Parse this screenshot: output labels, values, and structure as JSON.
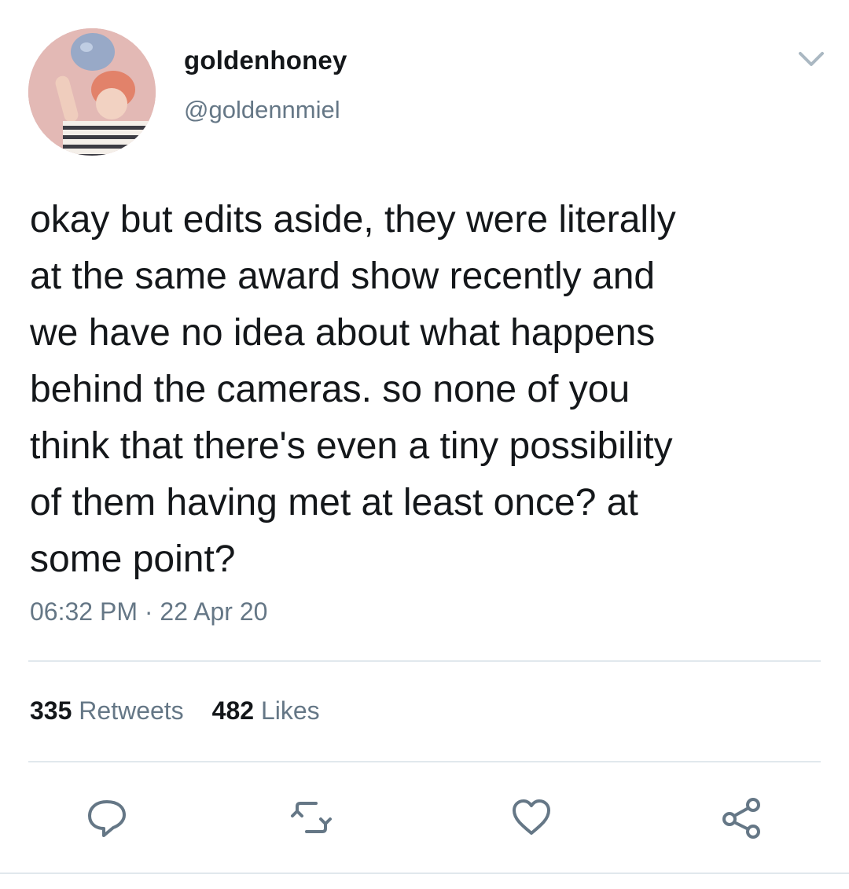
{
  "tweet": {
    "display_name": "goldenhoney",
    "handle": "@goldennmiel",
    "text": "okay but edits aside, they were literally\nat the same award show recently and\nwe have no idea about what happens\nbehind the cameras. so none of you\nthink that there's even a tiny possibility\nof them having met at least once? at\nsome point?",
    "timestamp": "06:32 PM · 22 Apr 20",
    "retweets_count": "335",
    "retweets_label": "Retweets",
    "likes_count": "482",
    "likes_label": "Likes"
  },
  "icons": {
    "menu": "chevron-down-icon",
    "reply": "reply-icon",
    "retweet": "retweet-icon",
    "like": "heart-icon",
    "share": "share-icon"
  },
  "colors": {
    "text": "#14171a",
    "secondary": "#657786",
    "divider": "#e1e8ed",
    "icon": "#657786"
  }
}
